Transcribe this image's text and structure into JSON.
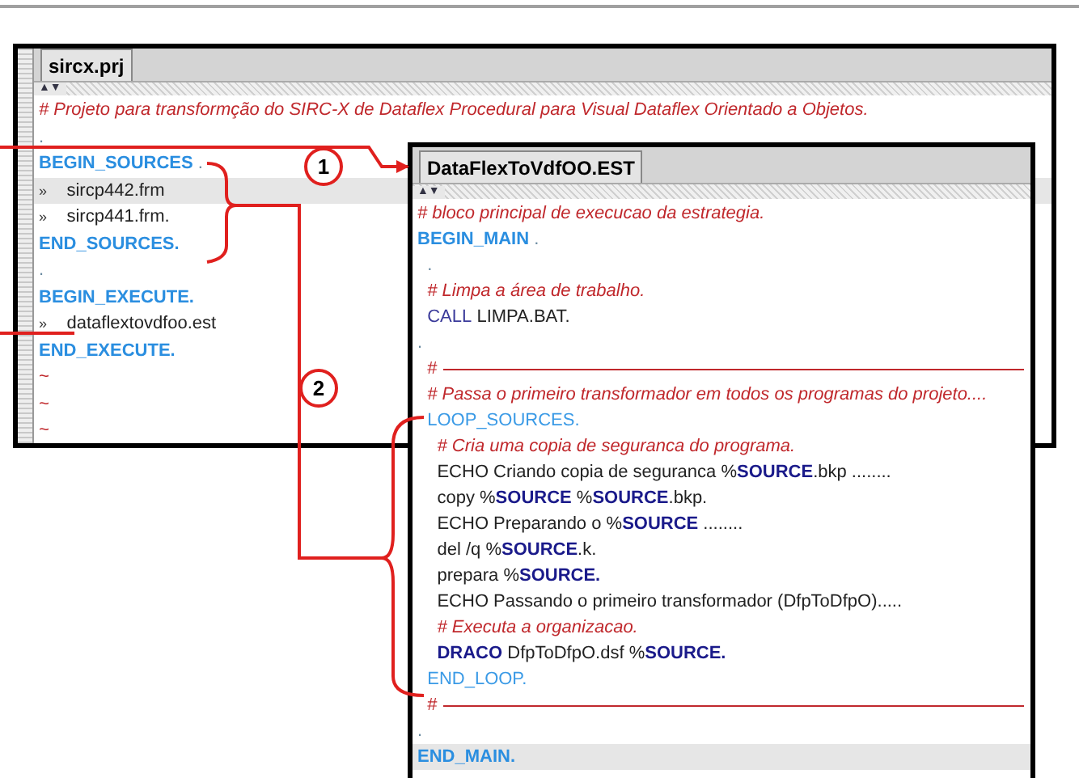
{
  "windows": [
    {
      "tab": {
        "label": "sircx.prj",
        "selected": true
      },
      "scroll_arrows": "▲▼",
      "lines": [
        {
          "highlighted": false,
          "segments": [
            {
              "kind": "comment",
              "text": "# Projeto para transformção do SIRC-X de Dataflex Procedural para Visual Dataflex Orientado a Objetos."
            }
          ]
        },
        {
          "highlighted": false,
          "segments": [
            {
              "kind": "dot",
              "text": "."
            }
          ]
        },
        {
          "highlighted": false,
          "segments": [
            {
              "kind": "keyword",
              "text": "BEGIN_SOURCES"
            },
            {
              "kind": "dot",
              "text": " ."
            }
          ]
        },
        {
          "highlighted": true,
          "segments": [
            {
              "kind": "marker",
              "text": "»"
            },
            {
              "kind": "plain",
              "text": "    sircp442.frm"
            }
          ]
        },
        {
          "highlighted": false,
          "segments": [
            {
              "kind": "marker",
              "text": "»"
            },
            {
              "kind": "plain",
              "text": "    sircp441.frm."
            }
          ]
        },
        {
          "highlighted": false,
          "segments": [
            {
              "kind": "keyword",
              "text": "END_SOURCES."
            }
          ]
        },
        {
          "highlighted": false,
          "segments": [
            {
              "kind": "dot",
              "text": "."
            }
          ]
        },
        {
          "highlighted": false,
          "segments": [
            {
              "kind": "keyword",
              "text": "BEGIN_EXECUTE."
            }
          ]
        },
        {
          "highlighted": false,
          "segments": [
            {
              "kind": "marker",
              "text": "»"
            },
            {
              "kind": "plain",
              "text": "    dataflextovdfoo.est"
            }
          ]
        },
        {
          "highlighted": false,
          "segments": [
            {
              "kind": "keyword",
              "text": "END_EXECUTE."
            }
          ]
        },
        {
          "highlighted": false,
          "segments": [
            {
              "kind": "tilde",
              "text": "~"
            }
          ]
        },
        {
          "highlighted": false,
          "segments": [
            {
              "kind": "tilde",
              "text": "~"
            }
          ]
        },
        {
          "highlighted": false,
          "segments": [
            {
              "kind": "tilde",
              "text": "~"
            }
          ]
        }
      ]
    },
    {
      "tab": {
        "label": "DataFlexToVdfOO.EST",
        "selected": true
      },
      "scroll_arrows": "▲▼",
      "lines": [
        {
          "highlighted": false,
          "segments": [
            {
              "kind": "comment",
              "text": "# bloco principal de execucao da estrategia."
            }
          ]
        },
        {
          "highlighted": false,
          "segments": [
            {
              "kind": "keyword",
              "text": "BEGIN_MAIN"
            },
            {
              "kind": "dot",
              "text": " ."
            }
          ]
        },
        {
          "highlighted": false,
          "segments": [
            {
              "kind": "dot",
              "text": "  ."
            }
          ]
        },
        {
          "highlighted": false,
          "segments": [
            {
              "kind": "comment",
              "text": "  # Limpa a área de trabalho."
            }
          ]
        },
        {
          "highlighted": false,
          "segments": [
            {
              "kind": "command",
              "text": "  CALL"
            },
            {
              "kind": "plain",
              "text": " LIMPA.BAT."
            }
          ]
        },
        {
          "highlighted": false,
          "segments": [
            {
              "kind": "dot",
              "text": "."
            }
          ]
        },
        {
          "highlighted": false,
          "segments": [
            {
              "kind": "rule",
              "text": "  #"
            }
          ]
        },
        {
          "highlighted": false,
          "segments": [
            {
              "kind": "comment",
              "text": "  # Passa o primeiro transformador em todos os programas do projeto...."
            }
          ]
        },
        {
          "highlighted": false,
          "segments": [
            {
              "kind": "loop",
              "text": "  LOOP_SOURCES."
            }
          ]
        },
        {
          "highlighted": false,
          "segments": [
            {
              "kind": "comment",
              "text": "    # Cria uma copia de seguranca do programa."
            }
          ]
        },
        {
          "highlighted": false,
          "segments": [
            {
              "kind": "plain",
              "text": "    ECHO Criando copia de seguranca %"
            },
            {
              "kind": "source",
              "text": "SOURCE"
            },
            {
              "kind": "plain",
              "text": ".bkp ........"
            }
          ]
        },
        {
          "highlighted": false,
          "segments": [
            {
              "kind": "plain",
              "text": "    copy %"
            },
            {
              "kind": "source",
              "text": "SOURCE"
            },
            {
              "kind": "plain",
              "text": " %"
            },
            {
              "kind": "source",
              "text": "SOURCE"
            },
            {
              "kind": "plain",
              "text": ".bkp."
            }
          ]
        },
        {
          "highlighted": false,
          "segments": [
            {
              "kind": "plain",
              "text": "    ECHO Preparando o %"
            },
            {
              "kind": "source",
              "text": "SOURCE"
            },
            {
              "kind": "plain",
              "text": " ........"
            }
          ]
        },
        {
          "highlighted": false,
          "segments": [
            {
              "kind": "plain",
              "text": "    del /q %"
            },
            {
              "kind": "source",
              "text": "SOURCE"
            },
            {
              "kind": "plain",
              "text": ".k."
            }
          ]
        },
        {
          "highlighted": false,
          "segments": [
            {
              "kind": "plain",
              "text": "    prepara %"
            },
            {
              "kind": "source",
              "text": "SOURCE."
            }
          ]
        },
        {
          "highlighted": false,
          "segments": [
            {
              "kind": "plain",
              "text": "    ECHO Passando o primeiro transformador (DfpToDfpO)....."
            }
          ]
        },
        {
          "highlighted": false,
          "segments": [
            {
              "kind": "comment",
              "text": "    # Executa a organizacao."
            }
          ]
        },
        {
          "highlighted": false,
          "segments": [
            {
              "kind": "source",
              "text": "    DRACO"
            },
            {
              "kind": "plain",
              "text": " DfpToDfpO.dsf %"
            },
            {
              "kind": "source",
              "text": "SOURCE."
            }
          ]
        },
        {
          "highlighted": false,
          "segments": [
            {
              "kind": "loop",
              "text": "  END_LOOP."
            }
          ]
        },
        {
          "highlighted": false,
          "segments": [
            {
              "kind": "rule",
              "text": "  #"
            }
          ]
        },
        {
          "highlighted": false,
          "segments": [
            {
              "kind": "dot",
              "text": "."
            }
          ]
        },
        {
          "highlighted": true,
          "segments": [
            {
              "kind": "keyword",
              "text": "END_MAIN."
            }
          ]
        }
      ]
    }
  ],
  "callouts": [
    {
      "label": "1"
    },
    {
      "label": "2"
    }
  ]
}
